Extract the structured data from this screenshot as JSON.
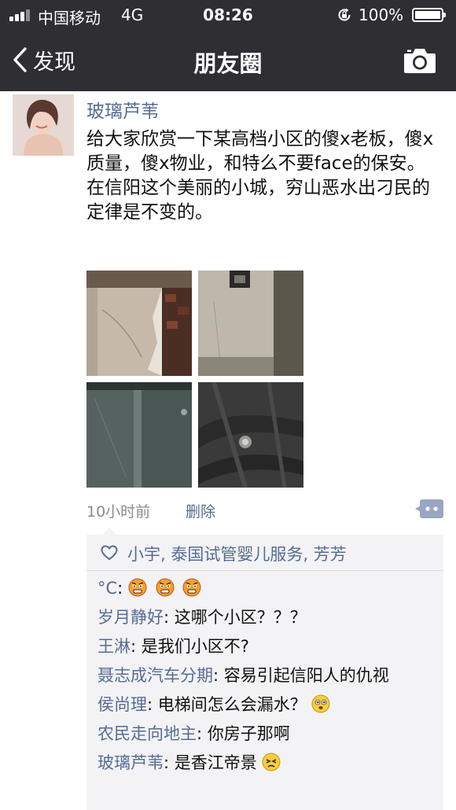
{
  "status_bar": {
    "carrier": "中国移动",
    "network": "4G",
    "time": "08:26",
    "battery_pct": "100%",
    "battery_level": 1.0
  },
  "nav": {
    "back_label": "发现",
    "title": "朋友圈"
  },
  "post": {
    "author": "玻璃芦苇",
    "content": "给大家欣赏一下某高档小区的傻x老板，傻x质量，傻x物业，和特么不要face的保安。在信阳这个美丽的小城，穷山恶水出刁民的定律是不变的。",
    "time_ago": "10小时前",
    "delete_label": "删除",
    "likes": "小宇, 泰国试管婴儿服务, 芳芳",
    "comments": [
      {
        "author": "°C",
        "sep": ": ",
        "text": ""
      },
      {
        "author": "岁月静好",
        "sep": ": ",
        "text": "这哪个小区？？？"
      },
      {
        "author": "王淋",
        "sep": ": ",
        "text": "是我们小区不?"
      },
      {
        "author": "聂志成汽车分期",
        "sep": ": ",
        "text": "容易引起信阳人的仇视"
      },
      {
        "author": "侯尚理",
        "sep": ": ",
        "text": "电梯间怎么会漏水？"
      },
      {
        "author": "农民走向地主",
        "sep": ": ",
        "text": "你房子那啊"
      },
      {
        "author": "玻璃芦苇",
        "sep": ": ",
        "text": "是香江帝景"
      }
    ]
  },
  "colors": {
    "bar_bg": "#2e2e33",
    "name_link": "#576b95",
    "comment_bg": "#f3f3f5"
  }
}
